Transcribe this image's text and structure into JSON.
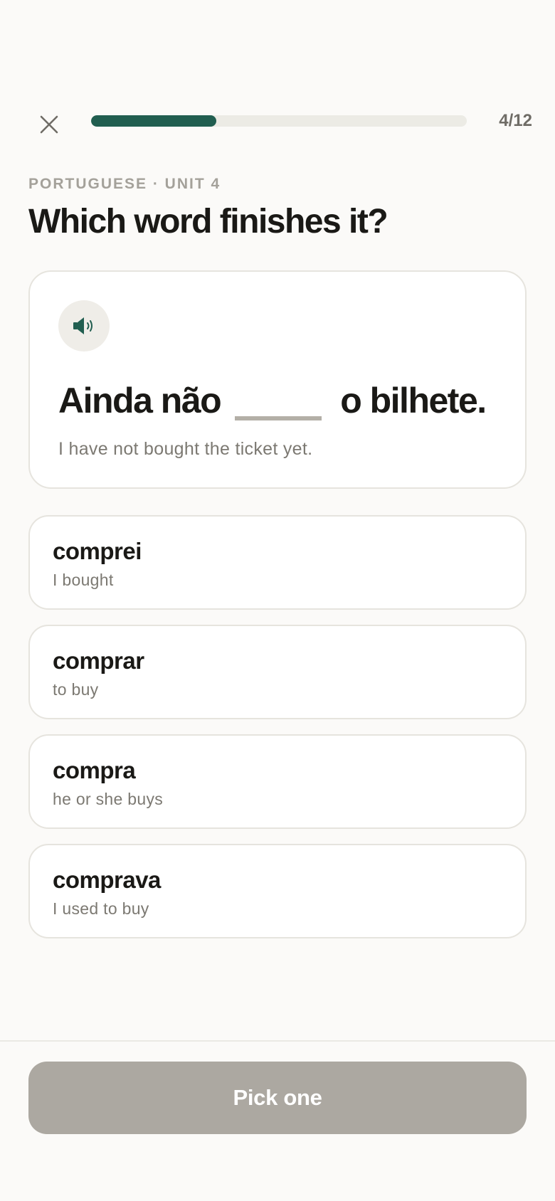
{
  "header": {
    "close_icon": "close-icon",
    "progress": {
      "current": 4,
      "total": 12,
      "fraction": 0.333,
      "label": "4/12",
      "color": "#215e50"
    }
  },
  "lesson": {
    "eyebrow": "PORTUGUESE · UNIT 4",
    "title": "Which word finishes it?"
  },
  "prompt": {
    "audio_icon": "speaker-icon",
    "before_blank": "Ainda não",
    "after_blank": "o bilhete.",
    "translation": "I have not bought the ticket yet."
  },
  "options": [
    {
      "word": "comprei",
      "gloss": "I bought"
    },
    {
      "word": "comprar",
      "gloss": "to buy"
    },
    {
      "word": "compra",
      "gloss": "he or she buys"
    },
    {
      "word": "comprava",
      "gloss": "I used to buy"
    }
  ],
  "footer": {
    "cta_label": "Pick one",
    "cta_state": "disabled"
  }
}
